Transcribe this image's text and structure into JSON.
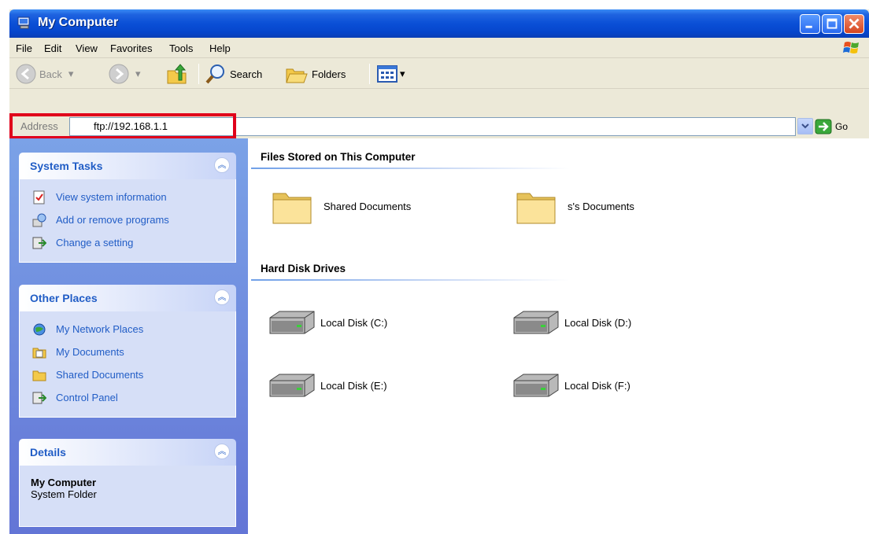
{
  "window": {
    "title": "My Computer"
  },
  "menu": [
    "File",
    "Edit",
    "View",
    "Favorites",
    "Tools",
    "Help"
  ],
  "toolbar": {
    "back": "Back",
    "search": "Search",
    "folders": "Folders"
  },
  "address": {
    "label": "Address",
    "value": "ftp://192.168.1.1",
    "go": "Go"
  },
  "tasks": {
    "system": {
      "title": "System Tasks",
      "items": [
        "View system information",
        "Add or remove programs",
        "Change a setting"
      ]
    },
    "other": {
      "title": "Other Places",
      "items": [
        "My Network Places",
        "My Documents",
        "Shared Documents",
        "Control Panel"
      ]
    },
    "details": {
      "title": "Details",
      "name": "My Computer",
      "type": "System Folder"
    }
  },
  "content": {
    "files_header": "Files Stored on This Computer",
    "folders": [
      "Shared Documents",
      "s's Documents"
    ],
    "drives_header": "Hard Disk Drives",
    "drives": [
      "Local Disk (C:)",
      "Local Disk (D:)",
      "Local Disk (E:)",
      "Local Disk (F:)"
    ]
  },
  "colors": {
    "title_bar": "#0a4fd6",
    "task_link": "#215dc6",
    "highlight": "#e0001b"
  }
}
